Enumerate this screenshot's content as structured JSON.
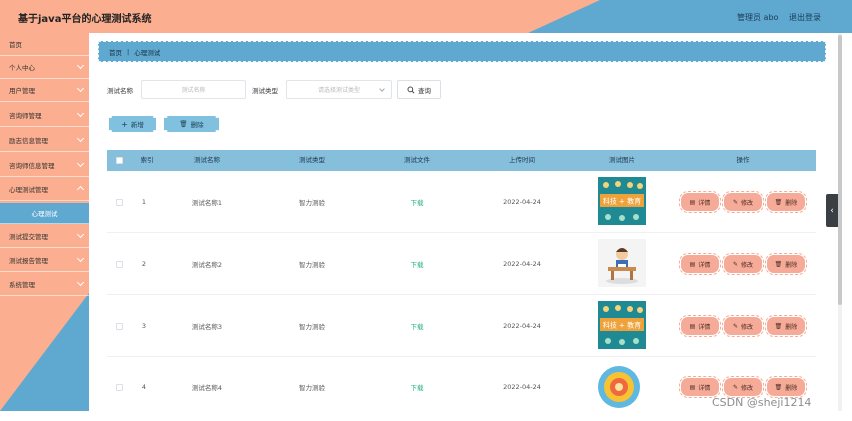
{
  "header": {
    "title": "基于java平台的心理测试系统",
    "user_text": "管理员 abo",
    "logout_label": "退出登录"
  },
  "sidebar": {
    "items": [
      {
        "label": "首页",
        "has_children": false
      },
      {
        "label": "个人中心",
        "has_children": true
      },
      {
        "label": "用户管理",
        "has_children": true
      },
      {
        "label": "咨询师管理",
        "has_children": true
      },
      {
        "label": "励志信息管理",
        "has_children": true
      },
      {
        "label": "咨询师信息管理",
        "has_children": true
      },
      {
        "label": "心理测试管理",
        "has_children": true
      }
    ],
    "active_sub": "心理测试",
    "items_after": [
      {
        "label": "测试提交管理",
        "has_children": true
      },
      {
        "label": "测试报告管理",
        "has_children": true
      },
      {
        "label": "系统管理",
        "has_children": true
      }
    ]
  },
  "breadcrumb": {
    "home": "首页",
    "current": "心理测试"
  },
  "search": {
    "name_label": "测试名称",
    "name_placeholder": "测试名称",
    "type_label": "测试类型",
    "type_placeholder": "请选择测试类型",
    "query_label": "查询"
  },
  "actions": {
    "add_label": "新增",
    "delete_label": "删除"
  },
  "table": {
    "headers": [
      "索引",
      "测试名称",
      "测试类型",
      "测试文件",
      "上传时间",
      "测试图片",
      "操作"
    ],
    "rows": [
      {
        "index": "1",
        "name": "测试名称1",
        "type": "智力测验",
        "file": "下载",
        "date": "2022-04-24",
        "image": "tech-edu-banner",
        "image_text": "科技 + 教育"
      },
      {
        "index": "2",
        "name": "测试名称2",
        "type": "智力测验",
        "file": "下载",
        "date": "2022-04-24",
        "image": "student-at-desk",
        "image_text": ""
      },
      {
        "index": "3",
        "name": "测试名称3",
        "type": "智力测验",
        "file": "下载",
        "date": "2022-04-24",
        "image": "tech-edu-banner",
        "image_text": "科技 + 教育"
      },
      {
        "index": "4",
        "name": "测试名称4",
        "type": "智力测验",
        "file": "下载",
        "date": "2022-04-24",
        "image": "round-target-badge",
        "image_text": ""
      }
    ],
    "ops": {
      "detail": "详情",
      "edit": "修改",
      "delete": "删除"
    }
  },
  "watermark": "CSDN @sheji1214",
  "colors": {
    "salmon": "#fbae90",
    "blue": "#5fa9d1",
    "table_header": "#86bfdc",
    "op_button": "#f5ab97",
    "link_green": "#22b07d"
  }
}
